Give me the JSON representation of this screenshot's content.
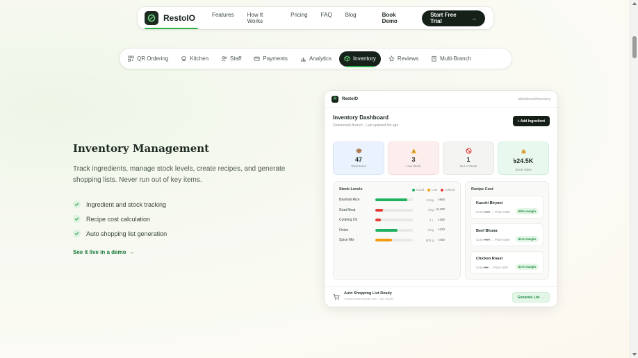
{
  "brand": {
    "name": "RestoIO"
  },
  "nav": {
    "links": [
      "Features",
      "How It Works",
      "Pricing",
      "FAQ",
      "Blog"
    ],
    "book_demo": "Book Demo",
    "cta": "Start Free Trial",
    "cta_arrow": "→"
  },
  "tabs": [
    {
      "label": "QR Ordering",
      "icon": "qr-icon"
    },
    {
      "label": "Kitchen",
      "icon": "chef-hat-icon"
    },
    {
      "label": "Staff",
      "icon": "users-icon"
    },
    {
      "label": "Payments",
      "icon": "card-icon"
    },
    {
      "label": "Analytics",
      "icon": "chart-icon"
    },
    {
      "label": "Inventory",
      "icon": "box-icon",
      "active": true
    },
    {
      "label": "Reviews",
      "icon": "star-icon"
    },
    {
      "label": "Multi-Branch",
      "icon": "building-icon"
    }
  ],
  "hero": {
    "title": "Inventory Management",
    "description": "Track ingredients, manage stock levels, create recipes, and generate shopping lists. Never run out of key items.",
    "bullets": [
      "Ingredient and stock tracking",
      "Recipe cost calculation",
      "Auto shopping list generation"
    ],
    "demo_link": "See it live in a demo",
    "demo_arrow": "→"
  },
  "dashboard": {
    "brand": "RestoIO",
    "path": "/dashboard/inventory",
    "title": "Inventory Dashboard",
    "subtitle": "Dhanmondi Branch · Last updated 5m ago",
    "add_button": "+ Add Ingredient",
    "stats": [
      {
        "value": "47",
        "label": "Total Items",
        "bg": "#eaf2fd",
        "border": "#d7e6fa"
      },
      {
        "value": "3",
        "label": "Low Stock",
        "bg": "#fdeeee",
        "border": "#f6dcdc"
      },
      {
        "value": "1",
        "label": "Out of Stock",
        "bg": "#f4f5f2",
        "border": "#e7e9e4"
      },
      {
        "value": "৳24.5K",
        "label": "Stock Value",
        "bg": "#e9f8ef",
        "border": "#d2f0dc"
      }
    ],
    "stock": {
      "title": "Stock Levels",
      "legend": [
        "Good",
        "Low",
        "Critical"
      ],
      "legend_colors": [
        "#21b35a",
        "#f39c12",
        "#e53935"
      ],
      "rows": [
        {
          "name": "Basmati Rice",
          "qty": "12 kg",
          "price": "৳960",
          "level": 0.85,
          "color": "#1fb15f"
        },
        {
          "name": "Goat Meat",
          "qty": "3 kg",
          "price": "৳2,400",
          "level": 0.2,
          "color": "#e53935"
        },
        {
          "name": "Cooking Oil",
          "qty": "2 L",
          "price": "৳360",
          "level": 0.15,
          "color": "#e53935"
        },
        {
          "name": "Onion",
          "qty": "8 kg",
          "price": "৳320",
          "level": 0.6,
          "color": "#1fb15f"
        },
        {
          "name": "Spice Mix",
          "qty": "500 g",
          "price": "৳450",
          "level": 0.45,
          "color": "#f39c12"
        }
      ]
    },
    "recipes": {
      "title": "Recipe Cost",
      "items": [
        {
          "name": "Kacchi Biryani",
          "cost_label": "Cost",
          "cost": "৳142",
          "price_label": "Price",
          "price": "৳350",
          "margin": "59% margin"
        },
        {
          "name": "Beef Bhuna",
          "cost_label": "Cost",
          "cost": "৳118",
          "price_label": "Price",
          "price": "৳280",
          "margin": "61% margin"
        },
        {
          "name": "Chicken Roast",
          "cost_label": "Cost",
          "cost": "৳85",
          "price_label": "Price",
          "price": "৳220",
          "margin": "61% margin"
        }
      ]
    },
    "footer": {
      "title": "Auto Shopping List Ready",
      "subtitle": "4 items below reorder level · Est. ৳4,200",
      "button": "Generate List →"
    }
  }
}
